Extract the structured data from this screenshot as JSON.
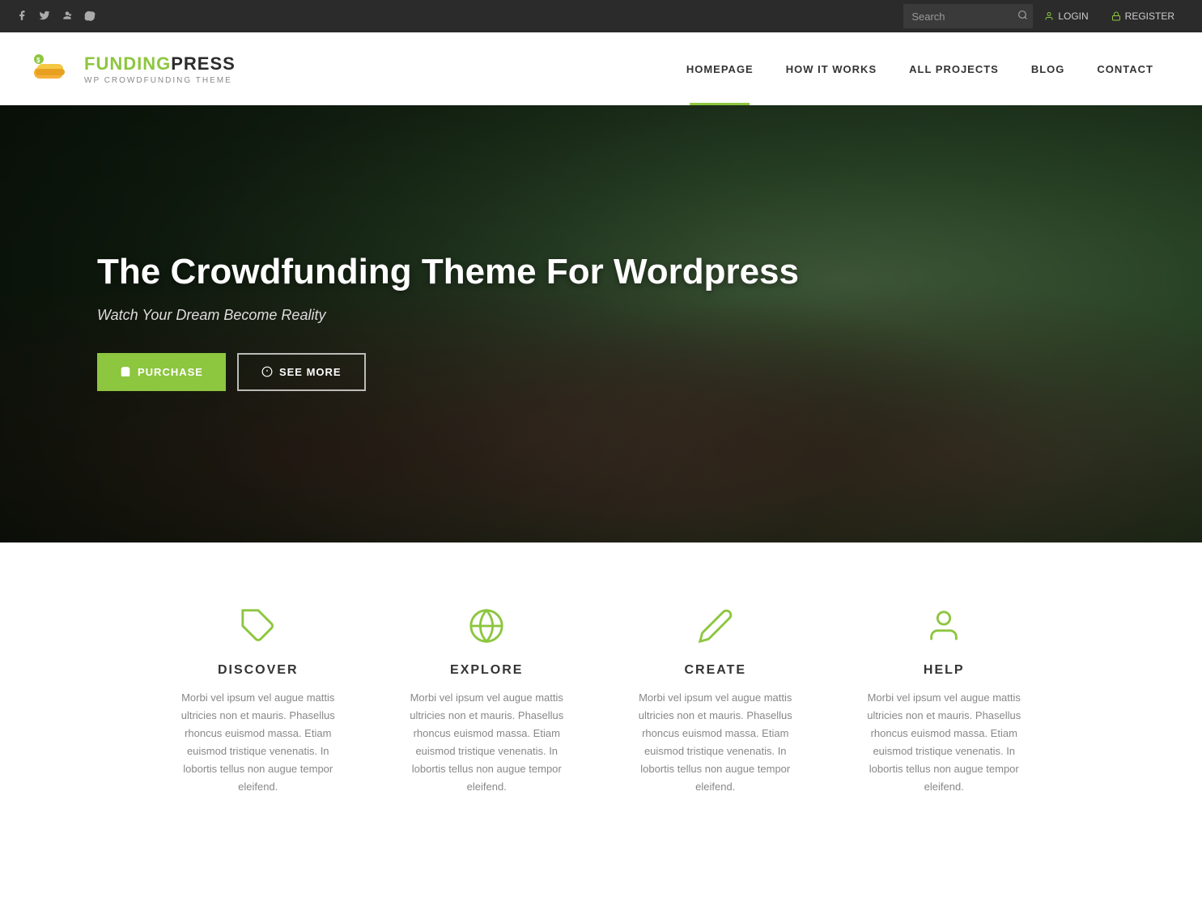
{
  "topbar": {
    "social": [
      {
        "name": "facebook",
        "symbol": "f"
      },
      {
        "name": "twitter",
        "symbol": "t"
      },
      {
        "name": "google-plus",
        "symbol": "g+"
      },
      {
        "name": "skype",
        "symbol": "s"
      }
    ],
    "search_placeholder": "Search",
    "login_label": "LOGIN",
    "register_label": "REGISTER"
  },
  "header": {
    "logo_text_green": "FUNDING",
    "logo_text_dark": "PRESS",
    "logo_sub": "WP CROWDFUNDING THEME",
    "nav": [
      {
        "label": "HOMEPAGE",
        "active": true
      },
      {
        "label": "HOW IT WORKS",
        "active": false
      },
      {
        "label": "ALL PROJECTS",
        "active": false
      },
      {
        "label": "BLOG",
        "active": false
      },
      {
        "label": "CONTACT",
        "active": false
      }
    ]
  },
  "hero": {
    "title": "The Crowdfunding Theme For Wordpress",
    "subtitle": "Watch Your Dream Become Reality",
    "purchase_label": "PURCHASE",
    "seemore_label": "SEE MORE"
  },
  "features": [
    {
      "id": "discover",
      "title": "DISCOVER",
      "icon": "tag",
      "desc": "Morbi vel ipsum vel augue mattis ultricies non et mauris. Phasellus rhoncus euismod massa. Etiam euismod tristique venenatis. In lobortis tellus non augue tempor eleifend."
    },
    {
      "id": "explore",
      "title": "EXPLORE",
      "icon": "globe",
      "desc": "Morbi vel ipsum vel augue mattis ultricies non et mauris. Phasellus rhoncus euismod massa. Etiam euismod tristique venenatis. In lobortis tellus non augue tempor eleifend."
    },
    {
      "id": "create",
      "title": "CREATE",
      "icon": "pencil",
      "desc": "Morbi vel ipsum vel augue mattis ultricies non et mauris. Phasellus rhoncus euismod massa. Etiam euismod tristique venenatis. In lobortis tellus non augue tempor eleifend."
    },
    {
      "id": "help",
      "title": "HELP",
      "icon": "person",
      "desc": "Morbi vel ipsum vel augue mattis ultricies non et mauris. Phasellus rhoncus euismod massa. Etiam euismod tristique venenatis. In lobortis tellus non augue tempor eleifend."
    }
  ]
}
